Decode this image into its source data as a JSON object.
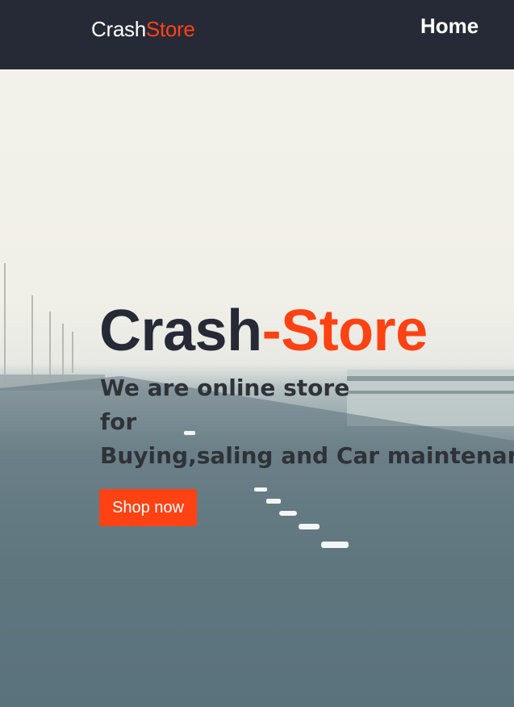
{
  "navbar": {
    "brand_part1": "Crash",
    "brand_part2": "Store",
    "home_label": "Home"
  },
  "hero": {
    "title_part1": "Crash",
    "title_part2": "-Store",
    "subtitle_line1": "We are online store",
    "subtitle_line2": "for",
    "subtitle_line3": "Buying,saling and Car maintenance",
    "button_label": "Shop now"
  },
  "colors": {
    "navbar_bg": "#262a36",
    "accent": "#ff4213",
    "title_dark": "#262a36"
  }
}
